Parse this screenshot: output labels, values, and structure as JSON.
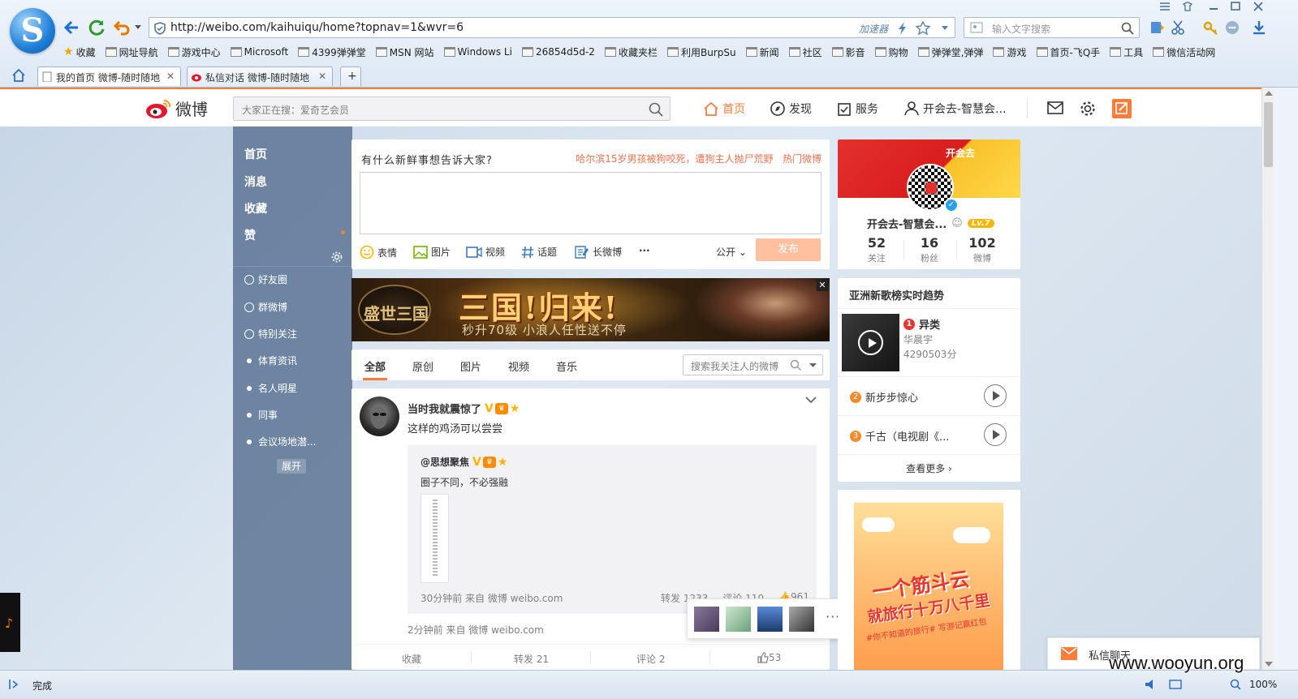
{
  "browser": {
    "url": "http://weibo.com/kaihuiqu/home?topnav=1&wvr=6",
    "accelerator_label": "加速器",
    "search_placeholder": "输入文字搜索",
    "status_text": "完成",
    "zoom": "100%",
    "bookmarks": [
      "收藏",
      "网址导航",
      "游戏中心",
      "Microsoft",
      "4399弹弹堂",
      "MSN 网站",
      "Windows Li",
      "26854d5d-2",
      "收藏夹栏",
      "利用BurpSu",
      "新闻",
      "社区",
      "影音",
      "购物",
      "弹弹堂,弹弹",
      "游戏",
      "首页-飞Q手",
      "工具",
      "微信活动网"
    ],
    "tabs": [
      {
        "title": "我的首页 微博-随时随地"
      },
      {
        "title": "私信对话 微博-随时随地"
      }
    ]
  },
  "weibo": {
    "logo_text": "微博",
    "search_placeholder": "大家正在搜：爱奇艺会员",
    "nav": {
      "home": "首页",
      "discover": "发现",
      "service": "服务",
      "user": "开会去-智慧会..."
    },
    "left_nav": {
      "primary": [
        "首页",
        "消息",
        "收藏",
        "赞"
      ],
      "groups": [
        "好友圈",
        "群微博",
        "特别关注",
        "体育资讯",
        "名人明星",
        "同事",
        "会议场地潜..."
      ],
      "expand": "展开"
    },
    "composer": {
      "prompt": "有什么新鲜事想告诉大家?",
      "hot_topic": "哈尔滨15岁男孩被狗咬死，遭狗主人抛尸荒野",
      "hot_label": "热门微博",
      "tools": [
        "表情",
        "图片",
        "视频",
        "话题",
        "长微博"
      ],
      "more": "···",
      "visibility": "公开",
      "publish": "发布"
    },
    "banner": {
      "headline": "三国!归来!",
      "sub": "秒升70级  小浪人任性送不停",
      "logo": "盛世三国"
    },
    "filters": {
      "tabs": [
        "全部",
        "原创",
        "图片",
        "视频",
        "音乐"
      ],
      "search_placeholder": "搜索我关注人的微博"
    },
    "post": {
      "author": "当时我就震惊了",
      "text": "这样的鸡汤可以尝尝",
      "repost": {
        "author": "@思想聚焦",
        "text": "圈子不同，不必强融",
        "meta": "30分钟前 来自 微博 weibo.com",
        "forward": "转发 1233",
        "comment": "评论 110",
        "like": "961"
      },
      "meta": "2分钟前 来自 微博 weibo.com",
      "actions": {
        "collect": "收藏",
        "forward": "转发 21",
        "comment": "评论 2",
        "like": "53"
      }
    },
    "like_popup_more": "···",
    "profile": {
      "brand": "开会去",
      "name": "开会去-智慧会...",
      "level": "Lv.7",
      "follow": {
        "n": "52",
        "label": "关注"
      },
      "fans": {
        "n": "16",
        "label": "粉丝"
      },
      "weibo": {
        "n": "102",
        "label": "微博"
      }
    },
    "music": {
      "title": "亚洲新歌榜实时趋势",
      "songs": [
        {
          "rank": "1",
          "name": "异类",
          "artist": "华晨宇",
          "score": "4290503分"
        },
        {
          "rank": "2",
          "name": "新步步惊心"
        },
        {
          "rank": "3",
          "name": "千古（电视剧《..."
        }
      ],
      "more": "查看更多 ›"
    },
    "ad": {
      "line1": "一个筋斗云",
      "line2": "就旅行十万八千里",
      "line3": "#你不知道的旅行# 写游记赢红包"
    },
    "chat_label": "私信聊天"
  },
  "watermark": "www.wooyun.org",
  "colors": {
    "accent": "#fa7d3c",
    "link_hot": "#eb7350",
    "publish_disabled": "#ffc09f",
    "left_nav": "#5e7a9c"
  }
}
